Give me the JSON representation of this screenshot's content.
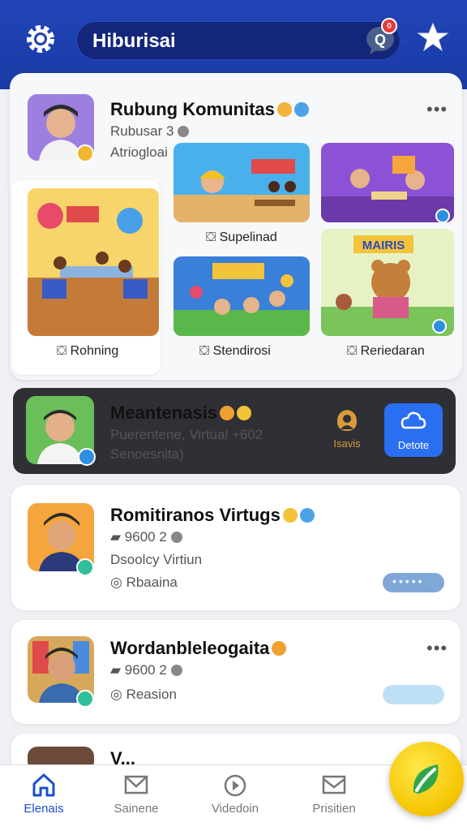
{
  "header": {
    "title": "Hiburisai",
    "notification_count": "0"
  },
  "featured": {
    "name": "Rubung Komunitas",
    "sub1": "Rubusar 3",
    "sub2": "Atriogloai",
    "tiles": [
      {
        "label": "Rohning"
      },
      {
        "label": "Supelinad"
      },
      {
        "label": "Stendirosi"
      },
      {
        "label": "Reriedaran"
      }
    ],
    "tile_sign_texts": [
      "",
      "",
      "MAIRIS"
    ]
  },
  "dark_card": {
    "name": "Meantenasis",
    "line1": "Puerentene, Virtual +602",
    "line2": "Senoesnita)",
    "follow_label": "Isavis",
    "join_label": "Detote"
  },
  "cards": [
    {
      "name": "Romitiranos Virtugs",
      "meta1": "9600 2",
      "meta2": "Dsoolcy Virtiun",
      "meta3": "Rbaaina"
    },
    {
      "name": "Wordanbleleogaita",
      "meta1": "9600 2",
      "meta3": "Reasion"
    },
    {
      "name": "V..."
    }
  ],
  "nav": {
    "items": [
      {
        "label": "Elenais",
        "icon": "home-icon"
      },
      {
        "label": "Sainene",
        "icon": "mail-icon"
      },
      {
        "label": "Videdoin",
        "icon": "video-icon"
      },
      {
        "label": "Prisitien",
        "icon": "inbox-icon"
      }
    ]
  },
  "colors": {
    "header_blue": "#1f43b4",
    "accent_blue": "#2a6ff2",
    "fab_yellow": "#f5c400"
  }
}
